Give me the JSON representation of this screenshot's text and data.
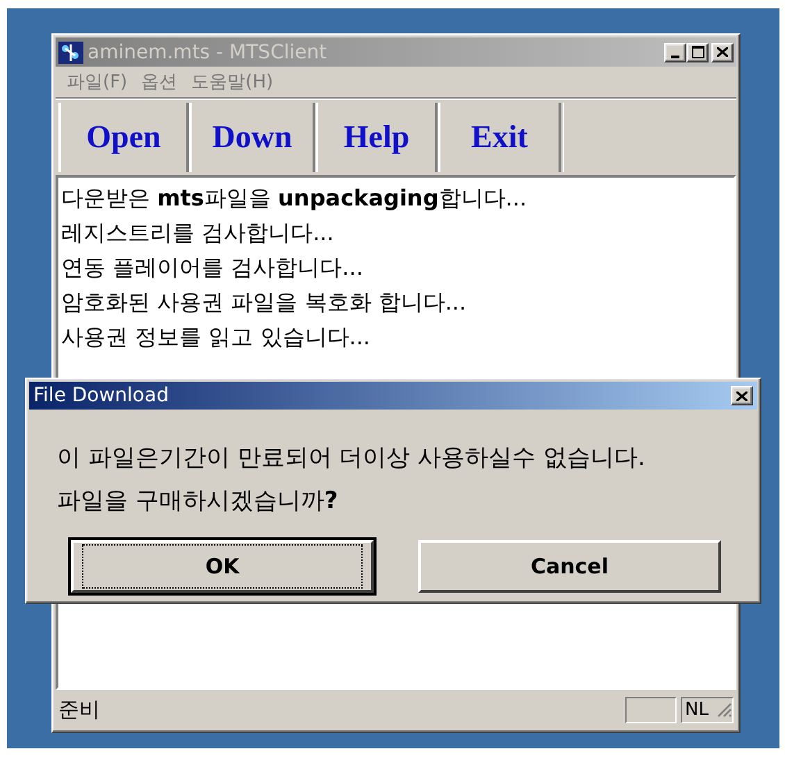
{
  "window": {
    "title": "aminem.mts - MTSClient",
    "active": false
  },
  "menu": [
    "파일(F)",
    "옵션",
    "도움말(H)"
  ],
  "toolbar": [
    "Open",
    "Down",
    "Help",
    "Exit"
  ],
  "log_lines": [
    "다운받은 **mts**파일을 **unpackaging**합니다...",
    "레지스트리를 검사합니다...",
    "연동 플레이어를 검사합니다...",
    "암호화된 사용권 파일을 복호화 합니다...",
    "사용권 정보를 읽고 있습니다..."
  ],
  "status_bar": {
    "text": "준비",
    "indicator": "NL"
  },
  "dialog": {
    "title": "File Download",
    "active": true,
    "message": [
      "이 파일은기간이 만료되어 더이상 사용하실수 없습니다.",
      "파일을 구매하시겠습니까**?**"
    ],
    "buttons": [
      {
        "label": "OK",
        "default": true
      },
      {
        "label": "Cancel",
        "default": false
      }
    ]
  }
}
